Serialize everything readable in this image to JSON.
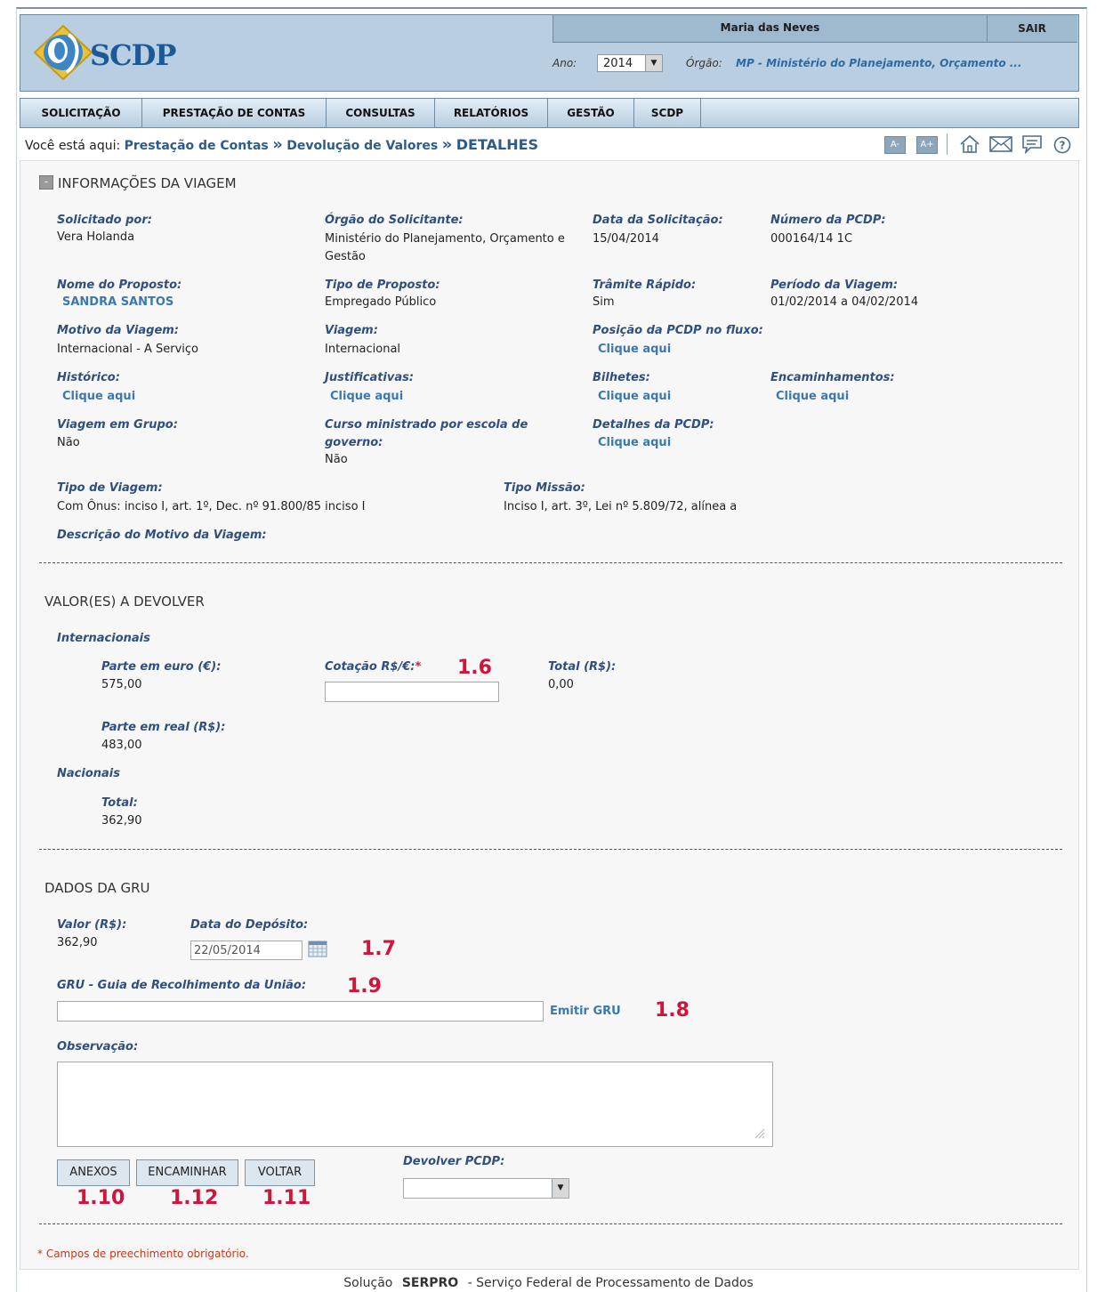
{
  "header": {
    "logo_text": "SCDP",
    "user_name": "Maria das Neves",
    "logout_label": "SAIR",
    "year_label": "Ano:",
    "year_value": "2014",
    "orgao_label": "Órgão:",
    "orgao_value": "MP - Ministério do Planejamento, Orçamento ..."
  },
  "nav": {
    "items": [
      "SOLICITAÇÃO",
      "PRESTAÇÃO DE CONTAS",
      "CONSULTAS",
      "RELATÓRIOS",
      "GESTÃO",
      "SCDP"
    ]
  },
  "breadcrumb": {
    "prefix": "Você está aqui:",
    "item1": "Prestação de Contas",
    "item2": "Devolução de Valores",
    "current": "DETALHES",
    "sep": "»"
  },
  "tools": {
    "font_decrease": "A-",
    "font_increase": "A+"
  },
  "viagem": {
    "title": "INFORMAÇÕES DA VIAGEM",
    "solicitado_label": "Solicitado por:",
    "solicitado_value": "Vera Holanda",
    "orgao_sol_label": "Órgão do Solicitante:",
    "orgao_sol_value1": "Ministério do Planejamento, Orçamento e",
    "orgao_sol_value2": "Gestão",
    "data_sol_label": "Data da Solicitação:",
    "data_sol_value": "15/04/2014",
    "numero_label": "Número da PCDP:",
    "numero_value": "000164/14 1C",
    "nome_label": "Nome do Proposto:",
    "nome_value": "SANDRA SANTOS",
    "tipo_prop_label": "Tipo de Proposto:",
    "tipo_prop_value": "Empregado Público",
    "tramite_label": "Trâmite Rápido:",
    "tramite_value": "Sim",
    "periodo_label": "Período da Viagem:",
    "periodo_value": "01/02/2014 a 04/02/2014",
    "motivo_label": "Motivo da Viagem:",
    "motivo_value": "Internacional - A Serviço",
    "viagem_label": "Viagem:",
    "viagem_value": "Internacional",
    "posicao_label": "Posição da PCDP no fluxo:",
    "clique": "Clique aqui",
    "historico_label": "Histórico:",
    "justificativas_label": "Justificativas:",
    "bilhetes_label": "Bilhetes:",
    "encaminhamentos_label": "Encaminhamentos:",
    "grupo_label": "Viagem em Grupo:",
    "grupo_value": "Não",
    "curso_label1": "Curso ministrado por escola de",
    "curso_label2": "governo:",
    "curso_value": "Não",
    "detalhes_label": "Detalhes da PCDP:",
    "tipo_viagem_label": "Tipo de Viagem:",
    "tipo_viagem_value": "Com Ônus: inciso I, art. 1º, Dec. nº 91.800/85 inciso I",
    "tipo_missao_label": "Tipo Missão:",
    "tipo_missao_value": "Inciso I, art. 3º, Lei nº 5.809/72, alínea a",
    "descricao_label": "Descrição do Motivo da Viagem:"
  },
  "valores": {
    "title": "VALOR(ES) A DEVOLVER",
    "internacionais": "Internacionais",
    "euro_label": "Parte em euro (€):",
    "euro_value": "575,00",
    "cotacao_label": "Cotação R$/€:",
    "required_mark": "*",
    "cotacao_value": "",
    "total_label": "Total (R$):",
    "total_value": "0,00",
    "real_label": "Parte em real (R$):",
    "real_value": "483,00",
    "nacionais": "Nacionais",
    "nac_total_label": "Total:",
    "nac_total_value": "362,90"
  },
  "gru": {
    "title": "DADOS DA GRU",
    "valor_label": "Valor (R$):",
    "valor_value": "362,90",
    "data_label": "Data do Depósito:",
    "data_value": "22/05/2014",
    "gru_label": "GRU - Guia de Recolhimento da União:",
    "gru_value": "",
    "emitir": "Emitir GRU",
    "obs_label": "Observação:",
    "obs_value": "",
    "devolver_label": "Devolver PCDP:",
    "devolver_value": ""
  },
  "buttons": {
    "anexos": "ANEXOS",
    "encaminhar": "ENCAMINHAR",
    "voltar": "VOLTAR"
  },
  "annotations": {
    "a16": "1.6",
    "a17": "1.7",
    "a18": "1.8",
    "a19": "1.9",
    "a110": "1.10",
    "a112": "1.12",
    "a111": "1.11"
  },
  "required_note": "* Campos de preechimento obrigatório.",
  "footer": {
    "prefix": "Solução",
    "brand": "SERPRO",
    "suffix": "- Serviço Federal de Processamento de Dados"
  },
  "colors": {
    "header_bg": "#b9cfe1",
    "link": "#3b78b0",
    "label": "#2f4f7f",
    "annotation": "#d0143b"
  }
}
